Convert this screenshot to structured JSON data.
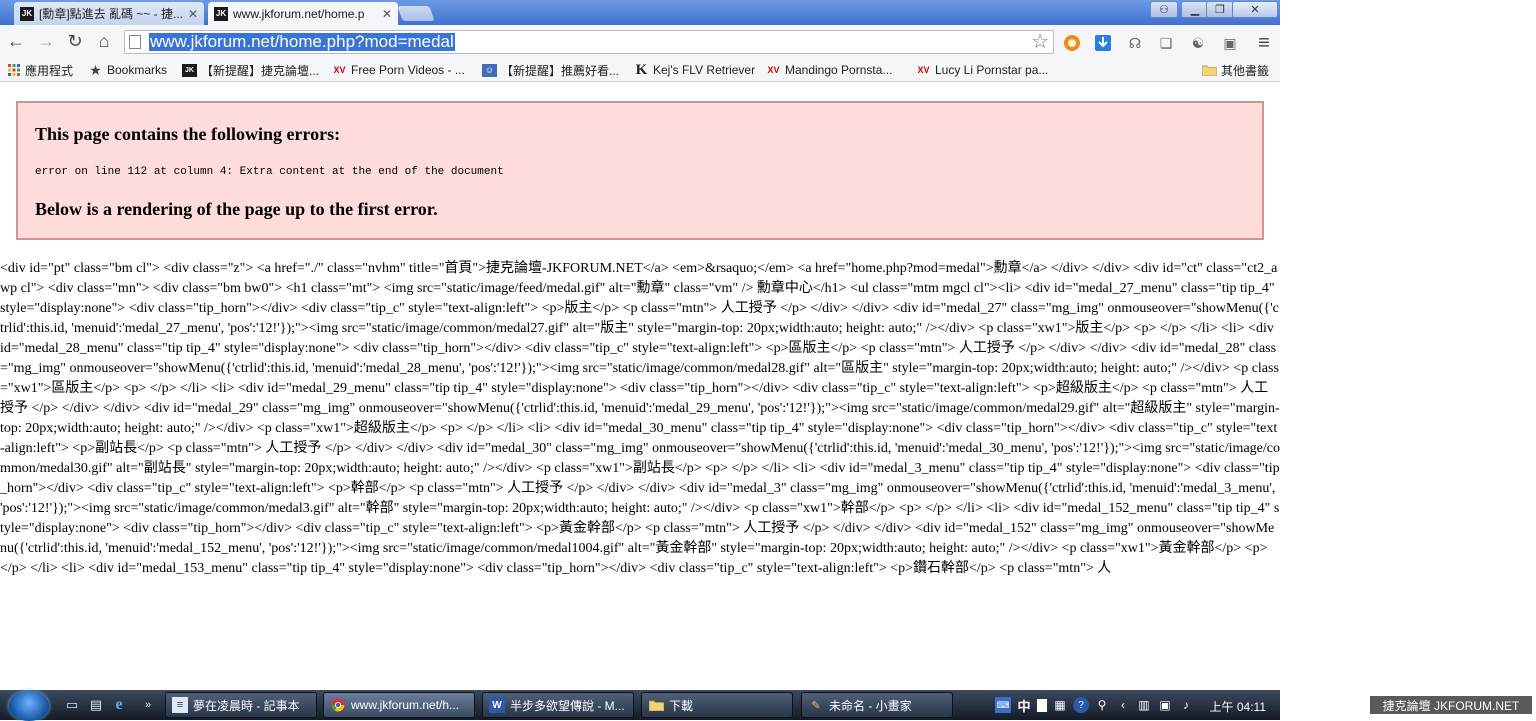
{
  "tabs": [
    {
      "favicon": "JK",
      "title": "[勳章]點進去 亂碼 ~~ - 捷...",
      "active": false
    },
    {
      "favicon": "JK",
      "title": "www.jkforum.net/home.p",
      "active": true
    }
  ],
  "window_controls": {
    "user": "⚇",
    "minimize": "▁",
    "maximize": "❐",
    "close": "✕"
  },
  "toolbar": {
    "back": "←",
    "forward": "→",
    "reload": "↻",
    "home": "⌂",
    "url": "www.jkforum.net/home.php?mod=medal",
    "star": "☆",
    "menu": "≡"
  },
  "bookmarks": [
    {
      "icon": "apps-grid-icon",
      "label": "應用程式"
    },
    {
      "icon": "star-icon",
      "label": "Bookmarks"
    },
    {
      "icon": "jk-favicon",
      "label": "【新提醒】捷克論壇..."
    },
    {
      "icon": "xv-favicon",
      "label": "Free Porn Videos - ..."
    },
    {
      "icon": "site-favicon",
      "label": "【新提醒】推薦好看..."
    },
    {
      "icon": "k-favicon",
      "label": "Kej's FLV Retriever"
    },
    {
      "icon": "xv-favicon",
      "label": "Mandingo Pornsta..."
    },
    {
      "icon": "xv-favicon",
      "label": "Lucy Li Pornstar pa..."
    },
    {
      "icon": "folder-icon",
      "label": "其他書籤"
    }
  ],
  "error": {
    "heading": "This page contains the following errors:",
    "message": "error on line 112 at column 4: Extra content at the end of the document",
    "subheading": "Below is a rendering of the page up to the first error."
  },
  "raw_content": "<div id=\"pt\" class=\"bm cl\"> <div class=\"z\"> <a href=\"./\" class=\"nvhm\" title=\"首頁\">捷克論壇-JKFORUM.NET</a> <em>&rsaquo;</em> <a href=\"home.php?mod=medal\">勳章</a> </div> </div>  <div id=\"ct\" class=\"ct2_a wp cl\"> <div class=\"mn\"> <div class=\"bm bw0\"> <h1 class=\"mt\"> <img src=\"static/image/feed/medal.gif\" alt=\"勳章\" class=\"vm\" /> 勳章中心</h1>  <ul class=\"mtm mgcl cl\"><li> <div id=\"medal_27_menu\" class=\"tip tip_4\" style=\"display:none\"> <div class=\"tip_horn\"></div> <div class=\"tip_c\" style=\"text-align:left\"> <p>版主</p> <p class=\"mtn\"> 人工授予 </p> </div> </div> <div id=\"medal_27\" class=\"mg_img\" onmouseover=\"showMenu({'ctrlid':this.id, 'menuid':'medal_27_menu', 'pos':'12!'});\"><img src=\"static/image/common/medal27.gif\" alt=\"版主\" style=\"margin-top: 20px;width:auto; height: auto;\" /></div> <p class=\"xw1\">版主</p> <p> </p> </li> <li> <div id=\"medal_28_menu\" class=\"tip tip_4\" style=\"display:none\"> <div class=\"tip_horn\"></div> <div class=\"tip_c\" style=\"text-align:left\"> <p>區版主</p> <p class=\"mtn\"> 人工授予 </p> </div> </div> <div id=\"medal_28\" class=\"mg_img\" onmouseover=\"showMenu({'ctrlid':this.id, 'menuid':'medal_28_menu', 'pos':'12!'});\"><img src=\"static/image/common/medal28.gif\" alt=\"區版主\" style=\"margin-top: 20px;width:auto; height: auto;\" /></div> <p class=\"xw1\">區版主</p> <p> </p> </li> <li> <div id=\"medal_29_menu\" class=\"tip tip_4\" style=\"display:none\"> <div class=\"tip_horn\"></div> <div class=\"tip_c\" style=\"text-align:left\"> <p>超級版主</p> <p class=\"mtn\"> 人工授予 </p> </div> </div> <div id=\"medal_29\" class=\"mg_img\" onmouseover=\"showMenu({'ctrlid':this.id, 'menuid':'medal_29_menu', 'pos':'12!'});\"><img src=\"static/image/common/medal29.gif\" alt=\"超級版主\" style=\"margin-top: 20px;width:auto; height: auto;\" /></div> <p class=\"xw1\">超級版主</p> <p> </p> </li> <li> <div id=\"medal_30_menu\" class=\"tip tip_4\" style=\"display:none\"> <div class=\"tip_horn\"></div> <div class=\"tip_c\" style=\"text-align:left\"> <p>副站長</p> <p class=\"mtn\"> 人工授予 </p> </div> </div> <div id=\"medal_30\" class=\"mg_img\" onmouseover=\"showMenu({'ctrlid':this.id, 'menuid':'medal_30_menu', 'pos':'12!'});\"><img src=\"static/image/common/medal30.gif\" alt=\"副站長\" style=\"margin-top: 20px;width:auto; height: auto;\" /></div> <p class=\"xw1\">副站長</p> <p> </p> </li> <li> <div id=\"medal_3_menu\" class=\"tip tip_4\" style=\"display:none\"> <div class=\"tip_horn\"></div> <div class=\"tip_c\" style=\"text-align:left\"> <p>幹部</p> <p class=\"mtn\"> 人工授予 </p> </div> </div> <div id=\"medal_3\" class=\"mg_img\" onmouseover=\"showMenu({'ctrlid':this.id, 'menuid':'medal_3_menu', 'pos':'12!'});\"><img src=\"static/image/common/medal3.gif\" alt=\"幹部\" style=\"margin-top: 20px;width:auto; height: auto;\" /></div> <p class=\"xw1\">幹部</p> <p> </p> </li> <li> <div id=\"medal_152_menu\" class=\"tip tip_4\" style=\"display:none\"> <div class=\"tip_horn\"></div> <div class=\"tip_c\" style=\"text-align:left\"> <p>黃金幹部</p> <p class=\"mtn\"> 人工授予 </p> </div> </div> <div id=\"medal_152\" class=\"mg_img\" onmouseover=\"showMenu({'ctrlid':this.id, 'menuid':'medal_152_menu', 'pos':'12!'});\"><img src=\"static/image/common/medal1004.gif\" alt=\"黃金幹部\" style=\"margin-top: 20px;width:auto; height: auto;\" /></div> <p class=\"xw1\">黃金幹部</p> <p> </p> </li> <li> <div id=\"medal_153_menu\" class=\"tip tip_4\" style=\"display:none\"> <div class=\"tip_horn\"></div> <div class=\"tip_c\" style=\"text-align:left\"> <p>鑽石幹部</p> <p class=\"mtn\"> 人",
  "taskbar": {
    "tasks": [
      {
        "icon": "notepad-icon",
        "label": "夢在凌晨時 - 記事本"
      },
      {
        "icon": "chrome-icon",
        "label": "www.jkforum.net/h..."
      },
      {
        "icon": "word-icon",
        "label": "半步多欲望傳說 - M..."
      },
      {
        "icon": "folder-icon",
        "label": "下載"
      },
      {
        "icon": "paint-icon",
        "label": "未命名 - 小畫家"
      }
    ],
    "ime": "中",
    "clock": "上午 04:11"
  },
  "watermark": "捷克論壇 JKFORUM.NET"
}
